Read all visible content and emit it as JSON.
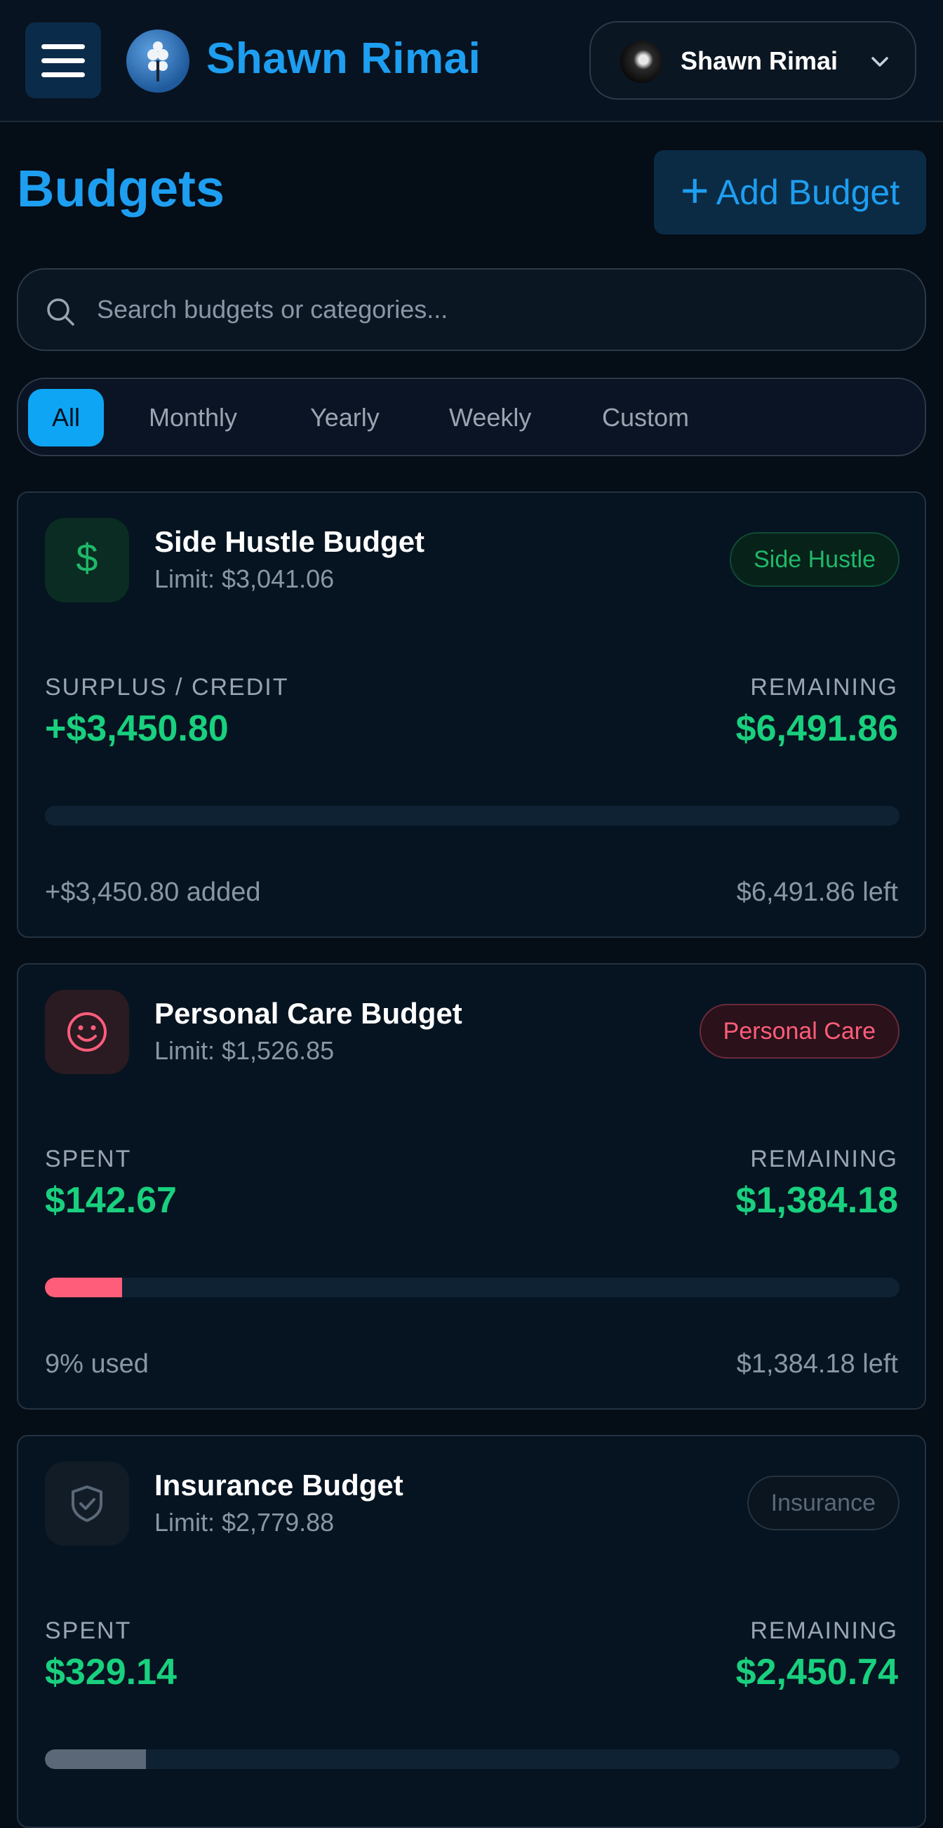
{
  "header": {
    "brand_name": "Shawn Rimai",
    "user_name": "Shawn Rimai"
  },
  "page": {
    "title": "Budgets",
    "add_button_label": "Add Budget",
    "search_placeholder": "Search budgets or categories..."
  },
  "filters": [
    "All",
    "Monthly",
    "Yearly",
    "Weekly",
    "Custom"
  ],
  "active_filter": "All",
  "budgets": [
    {
      "title": "Side Hustle Budget",
      "limit": "Limit: $3,041.06",
      "badge": "Side Hustle",
      "icon": "dollar-icon",
      "accent": "#1fb86a",
      "left_label": "SURPLUS / CREDIT",
      "left_value": "+$3,450.80",
      "right_label": "REMAINING",
      "right_value": "$6,491.86",
      "progress": 0,
      "foot_left": "+$3,450.80 added",
      "foot_right": "$6,491.86 left"
    },
    {
      "title": "Personal Care Budget",
      "limit": "Limit: $1,526.85",
      "badge": "Personal Care",
      "icon": "smiley-icon",
      "accent": "#ff5d7a",
      "left_label": "SPENT",
      "left_value": "$142.67",
      "right_label": "REMAINING",
      "right_value": "$1,384.18",
      "progress": 0.09,
      "foot_left": "9% used",
      "foot_right": "$1,384.18 left"
    },
    {
      "title": "Insurance Budget",
      "limit": "Limit: $2,779.88",
      "badge": "Insurance",
      "icon": "shield-check-icon",
      "accent": "#5a6878",
      "left_label": "SPENT",
      "left_value": "$329.14",
      "right_label": "REMAINING",
      "right_value": "$2,450.74",
      "progress": 0.118
    }
  ]
}
